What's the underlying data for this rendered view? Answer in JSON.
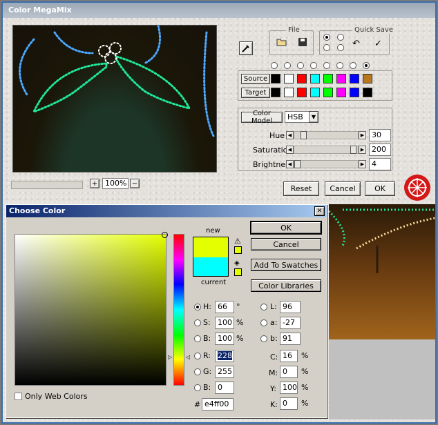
{
  "megamix": {
    "title": "Color MegaMix",
    "file_group_label": "File",
    "quick_save_label": "Quick Save",
    "zoom": "100%",
    "zoom_plus": "+",
    "zoom_minus": "−",
    "source_label": "Source",
    "target_label": "Target",
    "source_colors": [
      "#000000",
      "#ffffff",
      "#ff0000",
      "#00ffff",
      "#00ff00",
      "#ff00ff",
      "#0000ff",
      "#b8761e"
    ],
    "target_colors": [
      "#000000",
      "#ffffff",
      "#ff0000",
      "#00ffff",
      "#00ff00",
      "#ff00ff",
      "#0000ff",
      "#000000"
    ],
    "color_model_label": "Color Model",
    "color_model_value": "HSB",
    "hue_label": "Hue",
    "hue_value": "30",
    "hue_level": 0.12,
    "saturation_label": "Saturation",
    "saturation_value": "200",
    "saturation_level": 0.97,
    "brightness_label": "Brightness",
    "brightness_value": "4",
    "brightness_level": 0.01,
    "reset_label": "Reset",
    "cancel_label": "Cancel",
    "ok_label": "OK"
  },
  "choose_color": {
    "title": "Choose Color",
    "close": "✕",
    "new_label": "new",
    "current_label": "current",
    "new_color": "#e4ff00",
    "current_color": "#00ffff",
    "ok_label": "OK",
    "cancel_label": "Cancel",
    "add_swatches_label": "Add To Swatches",
    "libraries_label": "Color Libraries",
    "h_label": "H:",
    "h_value": "66",
    "h_unit": "°",
    "s_label": "S:",
    "s_value": "100",
    "s_unit": "%",
    "b_label": "B:",
    "b_value": "100",
    "b_unit": "%",
    "r_label": "R:",
    "r_value": "228",
    "g_label": "G:",
    "g_value": "255",
    "blue_label": "B:",
    "blue_value": "0",
    "l_label": "L:",
    "l_value": "96",
    "a_label": "a:",
    "a_value": "-27",
    "lab_b_label": "b:",
    "lab_b_value": "91",
    "c_label": "C:",
    "c_value": "16",
    "c_unit": "%",
    "m_label": "M:",
    "m_value": "0",
    "m_unit": "%",
    "y_label": "Y:",
    "y_value": "100",
    "y_unit": "%",
    "k_label": "K:",
    "k_value": "0",
    "k_unit": "%",
    "hex_label": "#",
    "hex_value": "e4ff00",
    "web_colors_label": "Only Web Colors"
  }
}
